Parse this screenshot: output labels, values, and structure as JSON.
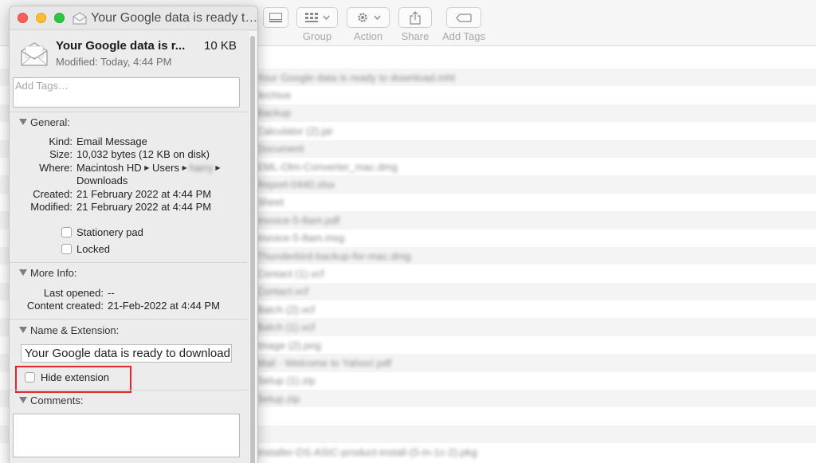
{
  "finder": {
    "toolbar": {
      "group_label": "Group",
      "action_label": "Action",
      "share_label": "Share",
      "add_tags_label": "Add Tags"
    },
    "rows": [
      "Your Google data is ready to download.mht",
      "Archive",
      "Backup",
      "Calculator (2).jar",
      "Document",
      "EML-Olm-Converter_mac.dmg",
      "Report-0440.xlsx",
      "Sheet",
      "Invoice-5-8am.pdf",
      "Invoice-5-8am.msg",
      "Thunderbird-backup-for-mac.dmg",
      "Contact (1).vcf",
      "Contact.vcf",
      "Batch (2).vcf",
      "Batch (1).vcf",
      "Image (2).png",
      "Mail - Welcome to Yahoo!.pdf",
      "Setup (1).zip",
      "Setup.zip",
      "",
      "",
      "Installer-DS-ASIC-product-install-(5-in-1c-2).pkg"
    ]
  },
  "info_window": {
    "title": "Your Google data is ready t…",
    "header": {
      "name": "Your Google data is r...",
      "size": "10 KB",
      "modified": "Modified: Today, 4:44 PM"
    },
    "tags_placeholder": "Add Tags…",
    "general": {
      "heading": "General:",
      "kind_label": "Kind:",
      "kind": "Email Message",
      "size_label": "Size:",
      "size": "10,032 bytes (12 KB on disk)",
      "where_label": "Where:",
      "where_part1": "Macintosh HD",
      "where_part2": "Users",
      "where_user": "harry",
      "where_part3": "Downloads",
      "created_label": "Created:",
      "created": "21 February 2022 at 4:44 PM",
      "modified_label": "Modified:",
      "modified": "21 February 2022 at 4:44 PM",
      "stationery_label": "Stationery pad",
      "locked_label": "Locked"
    },
    "more_info": {
      "heading": "More Info:",
      "last_opened_label": "Last opened:",
      "last_opened": "--",
      "content_created_label": "Content created:",
      "content_created": "21-Feb-2022 at 4:44 PM"
    },
    "name_ext": {
      "heading": "Name & Extension:",
      "value": "Your Google data is ready to download.mht",
      "hide_extension_label": "Hide extension"
    },
    "comments": {
      "heading": "Comments:"
    }
  }
}
